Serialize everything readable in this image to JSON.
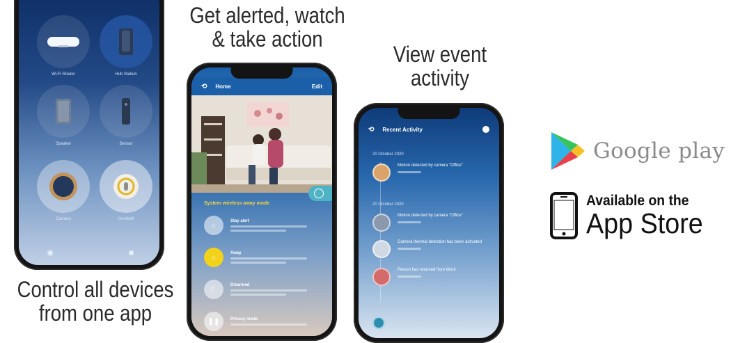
{
  "captions": {
    "alert_line1": "Get alerted, watch",
    "alert_line2": "& take action",
    "activity_line1": "View event",
    "activity_line2": "activity",
    "control_line1": "Control all devices",
    "control_line2": "from one app"
  },
  "phone_devices": {
    "devices": [
      {
        "icon": "router-icon",
        "label": "Wi-Fi Router"
      },
      {
        "icon": "base-station-icon",
        "label": "Hub Station"
      },
      {
        "icon": "speaker-icon",
        "label": "Speaker"
      },
      {
        "icon": "sensor-icon",
        "label": "Sensor"
      },
      {
        "icon": "camera-icon",
        "label": "Camera"
      },
      {
        "icon": "doorbell-icon",
        "label": "Doorbell"
      }
    ]
  },
  "phone_home": {
    "appbar": {
      "title": "Home",
      "action": "Edit"
    },
    "modes_heading": "System wireless away mode",
    "modes": [
      {
        "icon": "home-icon",
        "title": "Stay alert",
        "selected": false
      },
      {
        "icon": "away-icon",
        "title": "Away",
        "selected": true
      },
      {
        "icon": "night-icon",
        "title": "Disarmed",
        "selected": false
      },
      {
        "icon": "pause-icon",
        "title": "Privacy mode",
        "selected": false
      }
    ]
  },
  "phone_activity": {
    "appbar": {
      "title": "Recent Activity"
    },
    "groups": [
      {
        "date": "20 October 2020",
        "events": [
          {
            "title": "Motion detected by camera \"Office\""
          }
        ]
      },
      {
        "date": "20 October 2020",
        "events": [
          {
            "title": "Motion detected by camera \"Office\""
          },
          {
            "title": "Camera thermal detection has been activated"
          },
          {
            "title": "Person has returned from Work"
          }
        ]
      }
    ]
  },
  "stores": {
    "google_play": "Google play",
    "app_store_small": "Available on the",
    "app_store_big": "App Store"
  },
  "colors": {
    "app_blue": "#1b5fa8",
    "mode_selected": "#f3d21b",
    "mode_heading": "#f7d33a",
    "fab": "#4fb3c6"
  }
}
